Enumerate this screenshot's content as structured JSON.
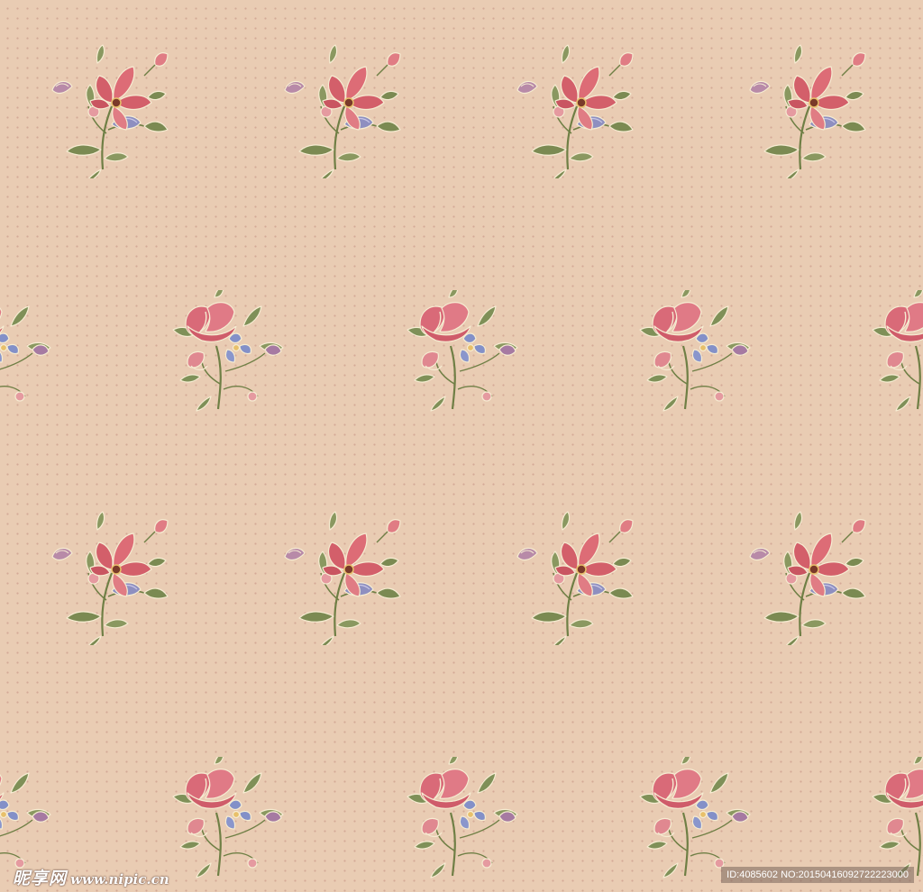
{
  "pattern": {
    "background_color": "#e9ccb3",
    "dot_color": "#c48c80",
    "motif_a": {
      "name": "pink-blossom-sprig",
      "petal_color": "#d9646e",
      "accent_color": "#8e8fc0",
      "leaf_color": "#7b8a52"
    },
    "motif_b": {
      "name": "rose-bud-sprig",
      "petal_color": "#d96a78",
      "accent_color": "#8390c8",
      "leaf_color": "#7f9058"
    }
  },
  "watermark": {
    "site_name_cn": "昵享网",
    "site_url": "www.nipic.cn",
    "id_text": "ID:4085602 NO:20150416092722223000"
  }
}
